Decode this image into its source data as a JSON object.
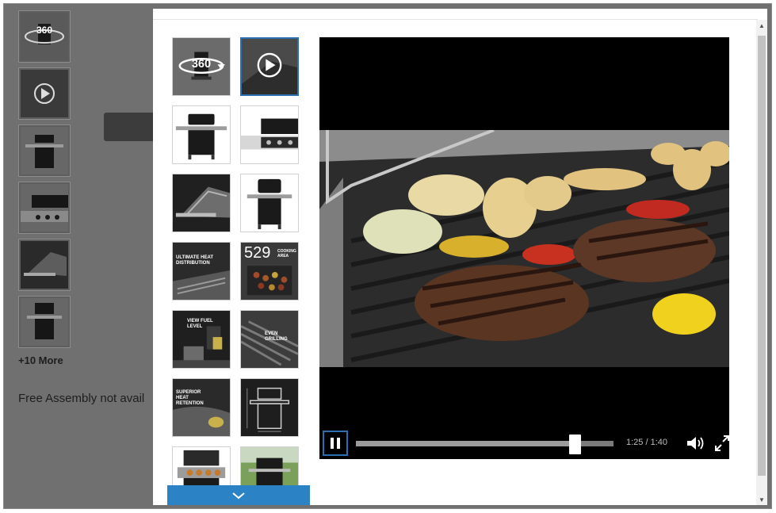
{
  "background_page": {
    "more_label": "+10 More",
    "assembly_text": "Free Assembly not avail"
  },
  "thumbnails": [
    {
      "kind": "360",
      "text": "360"
    },
    {
      "kind": "video"
    },
    {
      "kind": "grill-front"
    },
    {
      "kind": "grill-top"
    },
    {
      "kind": "grill-detail-dark"
    },
    {
      "kind": "grill-closed"
    },
    {
      "kind": "feature",
      "text": "ULTIMATE HEAT DISTRIBUTION"
    },
    {
      "kind": "feature-count",
      "text": "529",
      "subtext": "COOKING AREA"
    },
    {
      "kind": "feature",
      "text": "VIEW FUEL LEVEL"
    },
    {
      "kind": "feature",
      "text": "EVEN GRILLING"
    },
    {
      "kind": "feature",
      "text": "SUPERIOR HEAT RETENTION"
    },
    {
      "kind": "diagram"
    },
    {
      "kind": "grill-open"
    },
    {
      "kind": "grill-outdoor"
    }
  ],
  "player": {
    "progress": 0.85,
    "time_text": "1:25 / 1:40"
  },
  "icons": {
    "rotate": "360-rotate-icon",
    "play": "play-circle-icon",
    "pause": "pause-icon",
    "volume": "volume-icon",
    "fullscreen": "fullscreen-icon",
    "chevron": "chevron-down-icon"
  },
  "colors": {
    "accent": "#2b82c4",
    "focus_border": "#2a6fb0",
    "overlay": "#707070"
  }
}
